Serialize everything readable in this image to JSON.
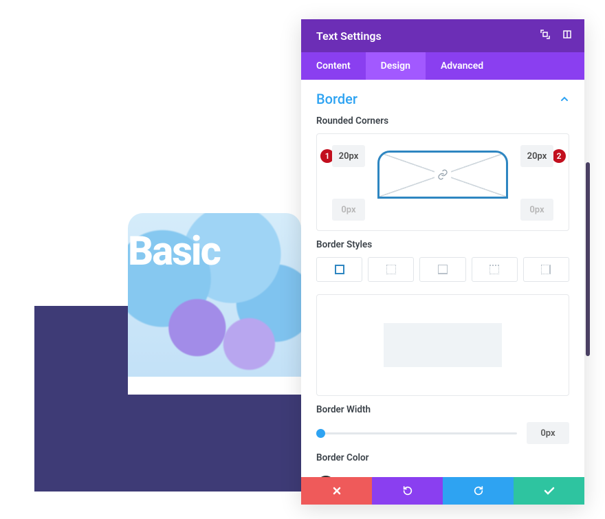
{
  "preview": {
    "title": "Basic"
  },
  "panel": {
    "title": "Text Settings",
    "tabs": {
      "content": "Content",
      "design": "Design",
      "advanced": "Advanced",
      "active": "design"
    },
    "section": {
      "title": "Border",
      "labels": {
        "rounded_corners": "Rounded Corners",
        "border_styles": "Border Styles",
        "border_width": "Border Width",
        "border_color": "Border Color"
      },
      "corners": {
        "tl": "20px",
        "tr": "20px",
        "bl": "0px",
        "br": "0px"
      },
      "width_value": "0px"
    }
  },
  "annotations": {
    "left": "1",
    "right": "2"
  }
}
